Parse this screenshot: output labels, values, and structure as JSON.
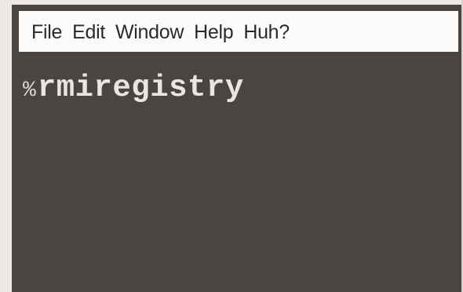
{
  "menubar": {
    "items": [
      {
        "label": "File"
      },
      {
        "label": "Edit"
      },
      {
        "label": "Window"
      },
      {
        "label": "Help"
      },
      {
        "label": "Huh?"
      }
    ]
  },
  "terminal": {
    "prompt": "%",
    "command": "rmiregistry"
  },
  "colors": {
    "terminal_background": "#4a4442",
    "menubar_background": "#fbfbf9",
    "text": "#e9e6e2"
  }
}
